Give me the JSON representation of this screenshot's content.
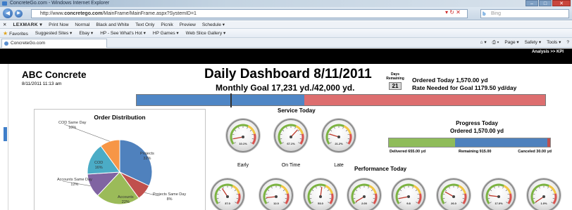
{
  "browser": {
    "window_title": "ConcreteGo.com - Windows Internet Explorer",
    "url_prefix": "http://www.",
    "url_domain": "concretego.com",
    "url_path": "/MainFrame/MainFrame.aspx?SystemID=1",
    "search_placeholder": "Bing",
    "toolbar_items": [
      "LEXMARK ▾",
      "Print Now",
      "Normal",
      "Black and White",
      "Text Only",
      "Picnik",
      "Preview",
      "Schedule ▾"
    ],
    "favorites_items": [
      "Favorites",
      "Suggested Sites ▾",
      "Ebay ▾",
      "HP - See What's Hot ▾",
      "HP Games ▾",
      "Web Slice Gallery ▾"
    ],
    "tab_title": "ConcreteGo.com",
    "command_items": [
      "Page ▾",
      "Safety ▾",
      "Tools ▾"
    ],
    "kpi_link": "Analysis >> KPI"
  },
  "dashboard": {
    "company": "ABC Concrete",
    "datetime": "8/11/2011 11:13 am",
    "title": "Daily Dashboard 8/11/2011",
    "monthly_goal_text": "Monthly Goal 17,231 yd./42,000 yd.",
    "days_remaining_label": "Days Remaining",
    "days_remaining_value": "21",
    "ordered_today_text": "Ordered Today 1,570.00 yd",
    "rate_needed_text": "Rate Needed for Goal  1179.50 yd/day",
    "goal_progress_fraction": 0.41,
    "goal_marker_fraction": 0.23
  },
  "order_distribution": {
    "title": "Order Distribution",
    "slices": [
      {
        "label": "Projects",
        "pct": "32%",
        "value": 32,
        "color": "#4f81bd"
      },
      {
        "label": "Projects Same Day",
        "pct": "8%",
        "value": 8,
        "color": "#c0504d"
      },
      {
        "label": "Accounts",
        "pct": "22%",
        "value": 22,
        "color": "#9bbb59"
      },
      {
        "label": "Accounts Same Day",
        "pct": "12%",
        "value": 12,
        "color": "#8064a2"
      },
      {
        "label": "COD",
        "pct": "16%",
        "value": 16,
        "color": "#4bacc6"
      },
      {
        "label": "COD Same Day",
        "pct": "10%",
        "value": 10,
        "color": "#f79646"
      }
    ]
  },
  "service_today": {
    "title": "Service Today",
    "gauges": [
      {
        "caption": "Early",
        "readout": "10.1%",
        "needle_fraction": 0.1
      },
      {
        "caption": "On Time",
        "readout": "67.1%",
        "needle_fraction": 0.67
      },
      {
        "caption": "Late",
        "readout": "21.2%",
        "needle_fraction": 0.21
      }
    ]
  },
  "progress_today": {
    "title": "Progress Today",
    "subtitle": "Ordered 1,570.00 yd",
    "delivered_label": "Delivered 655.00 yd",
    "remaining_label": "Remaining 915.00",
    "canceled_label": "Canceled 30.00 yd",
    "delivered_value": 655,
    "remaining_value": 915,
    "canceled_value": 30,
    "delivered_color": "#8fbc5a",
    "remaining_color": "#4f81bd",
    "canceled_color": "#c0504d"
  },
  "performance_today": {
    "title": "Performance Today",
    "gauges": [
      {
        "readout": "37.0",
        "needle_fraction": 0.37
      },
      {
        "readout": "12.0",
        "needle_fraction": 0.12
      },
      {
        "readout": "53.0",
        "needle_fraction": 0.53
      },
      {
        "readout": "2.00",
        "needle_fraction": 0.02
      },
      {
        "readout": "9.8",
        "needle_fraction": 0.1
      },
      {
        "readout": "26.0",
        "needle_fraction": 0.26
      },
      {
        "readout": "17.0%",
        "needle_fraction": 0.17
      },
      {
        "readout": "1.0%",
        "needle_fraction": 0.01
      }
    ]
  }
}
